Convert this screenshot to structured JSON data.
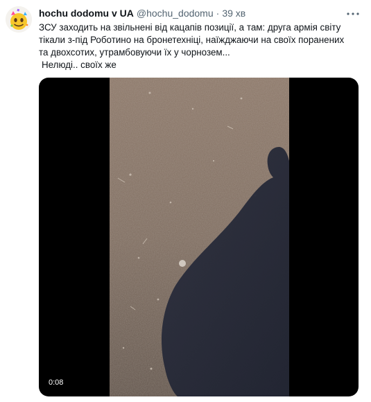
{
  "author": {
    "name": "hochu dodomu v UA",
    "handle": "@hochu_dodomu",
    "separator": "·",
    "time": "39 хв",
    "avatar_icon": "smiley-emoji-avatar"
  },
  "more_icon": "more-dots-icon",
  "text": {
    "line1": "ЗСУ заходить на звільнені від кацапів позиції, а там: друга армія світу",
    "line2": "тікали з-під Роботино на бронетехніці, наїжджаючи на своїх поранених",
    "line3": "та двохсотих, утрамбовуючи їх у чорнозем...",
    "line4": "Нелюді.. своїх же"
  },
  "media": {
    "type": "video",
    "duration": "0:08",
    "background_color": "#000000"
  }
}
